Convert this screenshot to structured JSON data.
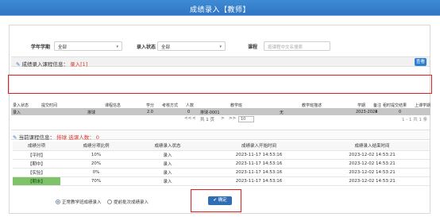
{
  "window": {
    "title": "成绩录入【教师】"
  },
  "filters": {
    "term_label": "学年学期",
    "term_value": "全部",
    "status_label": "录入状态",
    "status_value": "全部",
    "course_label": "课程",
    "course_placeholder": "按课程中文名搜索"
  },
  "course_section": {
    "title": "成绩录入课程信息：",
    "status": "录入[1]",
    "action_button": "查看",
    "headers": [
      "录入状态",
      "提交时间",
      "课程信息",
      "学分",
      "考核方式",
      "人数",
      "教学班",
      "教学班描述",
      "学期",
      "备注",
      "租时提交结果",
      "上课学期"
    ],
    "rows": [
      {
        "status": "录入",
        "course": "排球",
        "credits": "2.0",
        "count": "0",
        "class": "排球-0001",
        "desc": "无",
        "term": "2023-2024",
        "note": "1",
        "result": "0"
      }
    ],
    "pager": {
      "page_text": "共 1 页",
      "prev": "<",
      "next": ">",
      "first": "<<",
      "last": ">>",
      "page_size": "10",
      "range": "1 - 1 共 1 条"
    }
  },
  "current_section": {
    "title": "当前课程信息：",
    "course": "排球",
    "label_count": "选课人数：",
    "count": "0"
  },
  "grade_table": {
    "headers": [
      "成绩分项",
      "成绩分项比例",
      "成绩录入状态",
      "成绩录入开始时间",
      "成绩录入结束时间"
    ],
    "rows": [
      {
        "name": "【平时】",
        "ratio": "10%",
        "status": "录入",
        "start": "2023-11-17 14:53:16",
        "end": "2023-12-02 14:53:21"
      },
      {
        "name": "【期中】",
        "ratio": "20%",
        "status": "录入",
        "start": "2023-11-17 14:53:16",
        "end": "2023-12-02 14:53:21"
      },
      {
        "name": "【实验】",
        "ratio": "0%",
        "status": "录入",
        "start": "2023-11-17 14:53:16",
        "end": "2023-12-02 14:53:21"
      },
      {
        "name": "【期末】",
        "ratio": "70%",
        "status": "录入",
        "start": "2023-11-17 14:53:16",
        "end": "2023-12-02 14:53:21"
      }
    ]
  },
  "options": {
    "normal": "正常教学班成绩录入",
    "batch": "提前批次成绩录入"
  },
  "confirm_button": "确定",
  "colors": {
    "titlebar": "#2f74c2",
    "accent": "#2f7fd0",
    "highlight": "#e02020",
    "active_row": "#7ec36a"
  }
}
